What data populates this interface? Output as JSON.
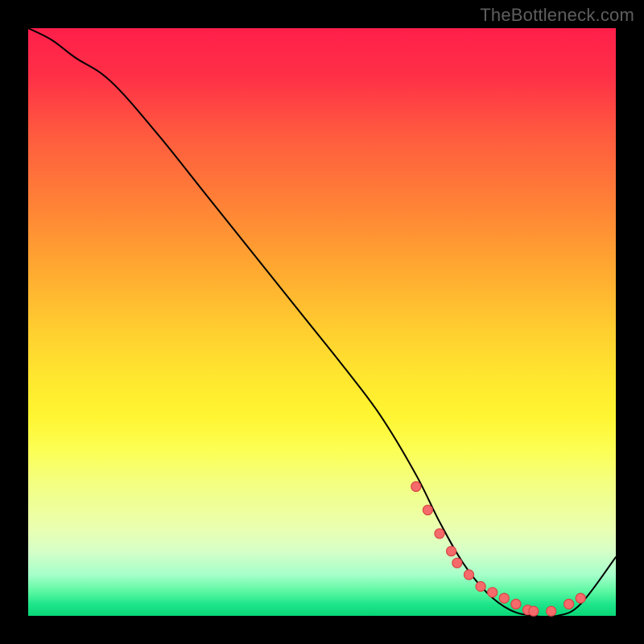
{
  "watermark": "TheBottleneck.com",
  "colors": {
    "background": "#000000",
    "curve": "#000000",
    "dot_fill": "#f56a6a",
    "dot_stroke": "#d94545"
  },
  "chart_data": {
    "type": "line",
    "title": "",
    "xlabel": "",
    "ylabel": "",
    "xlim": [
      0,
      100
    ],
    "ylim": [
      0,
      100
    ],
    "grid": false,
    "legend": false,
    "series": [
      {
        "name": "bottleneck-curve",
        "x": [
          0,
          4,
          8,
          14,
          22,
          30,
          38,
          46,
          54,
          60,
          66,
          70,
          74,
          78,
          82,
          86,
          90,
          94,
          100
        ],
        "y": [
          100,
          98,
          95,
          91,
          82,
          72,
          62,
          52,
          42,
          34,
          24,
          16,
          9,
          4,
          1,
          0,
          0,
          2,
          10
        ]
      }
    ],
    "markers": {
      "name": "highlight-dots",
      "x": [
        66,
        68,
        70,
        72,
        73,
        75,
        77,
        79,
        81,
        83,
        85,
        86,
        89,
        92,
        94
      ],
      "y": [
        22,
        18,
        14,
        11,
        9,
        7,
        5,
        4,
        3,
        2,
        1,
        0.8,
        0.8,
        2,
        3
      ]
    }
  }
}
